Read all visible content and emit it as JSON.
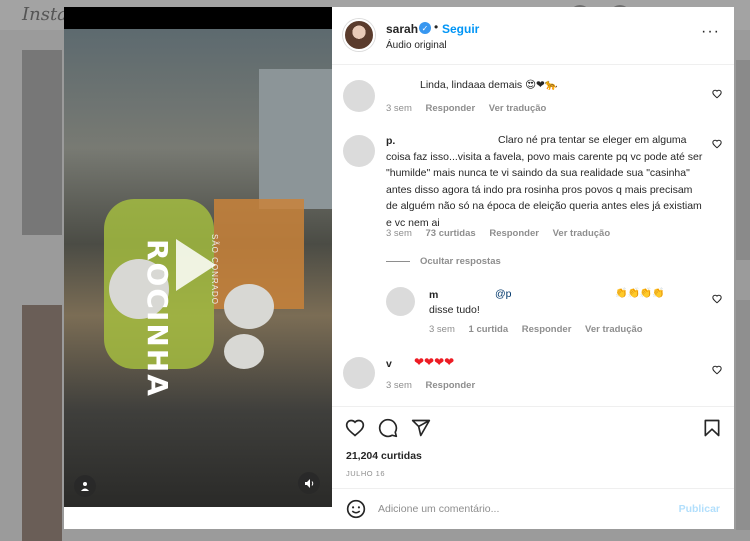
{
  "background": {
    "logo": "Insta"
  },
  "post": {
    "username": "sarah",
    "separator": "•",
    "follow_label": "Seguir",
    "audio": "Áudio original",
    "more_label": "···",
    "likes": "21,204 curtidas",
    "date": "JULHO 16"
  },
  "comments": [
    {
      "user": "",
      "text": "Linda, lindaaa demais",
      "emoji": "😍❤🐆",
      "time": "3 sem",
      "reply": "Responder",
      "translate": "Ver tradução"
    },
    {
      "user": "p.",
      "text": "Claro né pra tentar se eleger em alguma coisa faz isso...visita a favela, povo mais carente pq vc pode até ser \"humilde\" mais nunca te vi saindo da sua realidade sua \"casinha\" antes disso agora tá indo pra rosinha pros povos q mais precisam de alguém não só na época de eleição queria antes eles já existiam e vc nem ai",
      "time": "3 sem",
      "likes": "73 curtidas",
      "reply": "Responder",
      "translate": "Ver tradução",
      "hide_replies": "Ocultar respostas"
    },
    {
      "user": "m",
      "mention": "@p",
      "text": "disse tudo!",
      "emoji": "👏👏👏👏",
      "time": "3 sem",
      "likes": "1 curtida",
      "reply": "Responder",
      "translate": "Ver tradução"
    },
    {
      "user": "v",
      "emoji": "❤❤❤❤",
      "time": "3 sem",
      "reply": "Responder"
    }
  ],
  "composer": {
    "placeholder": "Adicione um comentário...",
    "post_label": "Publicar"
  },
  "video": {
    "overlay_text": "ROCINHA",
    "overlay_sub": "SÃO CONRADO"
  },
  "colors": {
    "link": "#0095f6",
    "verified": "#3897f0",
    "muted": "#8e8e8e",
    "post_disabled": "#b2dffc"
  }
}
